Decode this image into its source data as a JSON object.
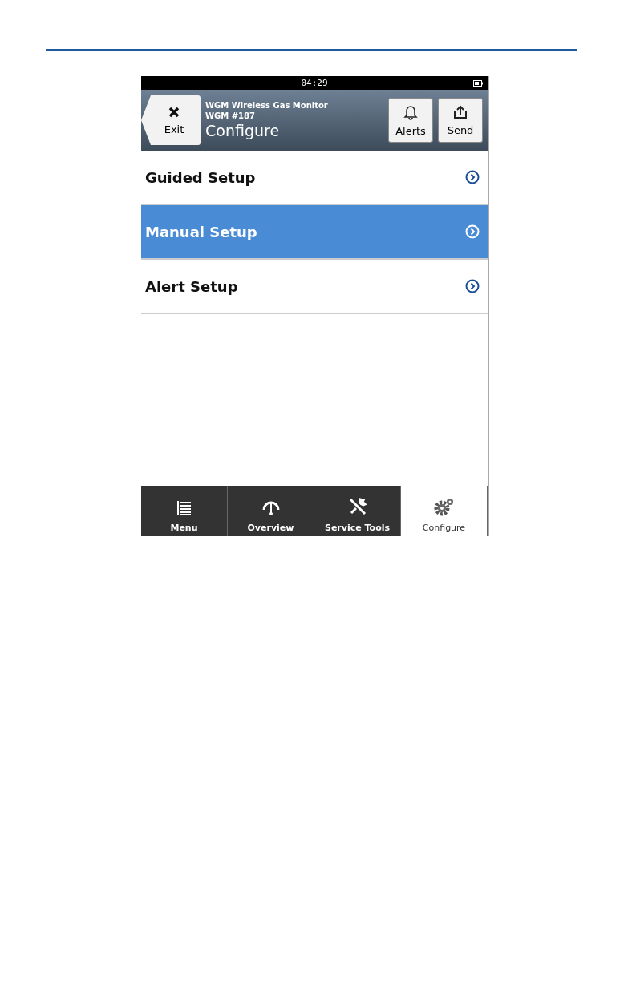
{
  "status_bar": {
    "time": "04:29"
  },
  "header": {
    "back_button": "Exit",
    "device": "WGM Wireless Gas Monitor",
    "tag": "WGM #187",
    "title": "Configure",
    "buttons": [
      {
        "kind": "alerts",
        "label": "Alerts"
      },
      {
        "kind": "send",
        "label": "Send"
      }
    ]
  },
  "menu_items": [
    {
      "label": "Guided Setup",
      "selected": false
    },
    {
      "label": "Manual Setup",
      "selected": true
    },
    {
      "label": "Alert Setup",
      "selected": false
    }
  ],
  "tabs": [
    {
      "kind": "menu",
      "label": "Menu",
      "selected": false
    },
    {
      "kind": "overview",
      "label": "Overview",
      "selected": false
    },
    {
      "kind": "tools",
      "label": "Service Tools",
      "selected": false
    },
    {
      "kind": "configure",
      "label": "Configure",
      "selected": true
    }
  ]
}
